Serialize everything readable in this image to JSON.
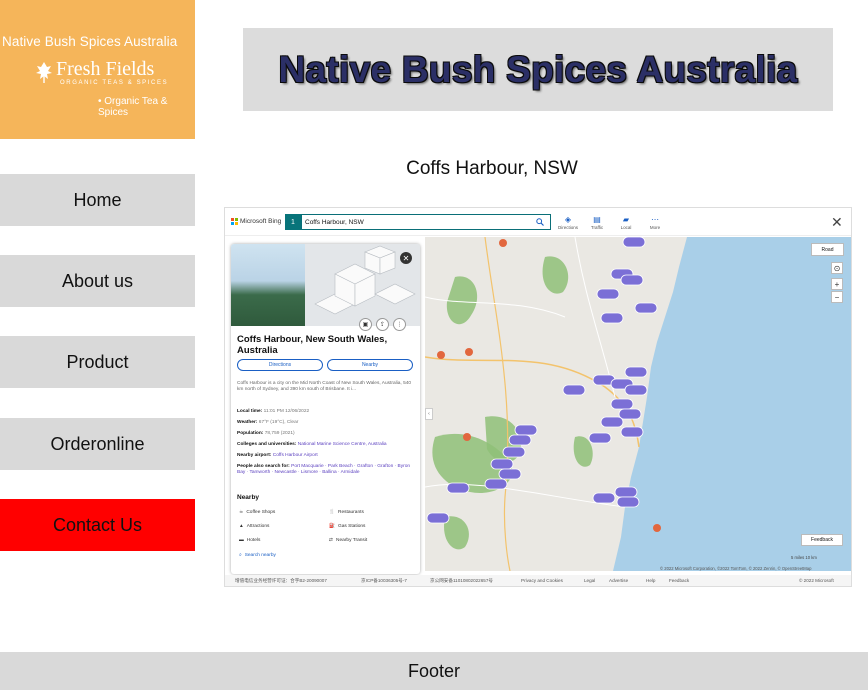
{
  "logo": {
    "line1": "Native Bush Spices Australia",
    "brand": "Fresh Fields",
    "subtitle": "ORGANIC TEAS & SPICES",
    "tagline": "• Organic Tea & Spices"
  },
  "nav": {
    "home": "Home",
    "about": "About us",
    "product": "Product",
    "order": "Orderonline",
    "contact": "Contact Us"
  },
  "banner": {
    "title": "Native Bush Spices Australia"
  },
  "location": {
    "title": "Coffs Harbour, NSW"
  },
  "map": {
    "brand": "Microsoft Bing",
    "result_number": "1",
    "search_value": "Coffs Harbour, NSW",
    "tools": [
      {
        "glyph": "◈",
        "label": "Directions"
      },
      {
        "glyph": "▤",
        "label": "Traffic"
      },
      {
        "glyph": "▰",
        "label": "Local"
      },
      {
        "glyph": "⋯",
        "label": "More"
      }
    ],
    "close": "✕",
    "road_label": "Road",
    "feedback_label": "Feedback",
    "copyright": "© 2022 Microsoft Corporation, ©2022 TomTom, © 2022 Zenrin, © OpenStreetMap",
    "scale_label": "5 miles          10 km",
    "panel": {
      "title": "Coffs Harbour, New South Wales, Australia",
      "directions_label": "Directions",
      "nearby_label": "Nearby",
      "description": "Coffs Harbour is a city on the Mid North Coast of New South Wales, Australia, 540 km north of Sydney, and 390 km south of Brisbane. It i...",
      "local_time_label": "Local time:",
      "local_time_value": "11:01 PM 12/06/2022",
      "weather_label": "Weather:",
      "weather_value": "67°F (19°C), Clear",
      "population_label": "Population:",
      "population_value": "78,759 (2021)",
      "colleges_label": "Colleges and universities:",
      "colleges_value": "National Marine Science Centre, Australia",
      "airport_label": "Nearby airport:",
      "airport_value": "Coffs Harbour Airport",
      "people_label": "People also search for:",
      "people_value": "Port Macquarie · Park Beach · Grafton · Grafton · Byron Bay · Tamworth · Newcastle · Lismore · Ballina · Armidale",
      "nearby_heading": "Nearby",
      "nearby": [
        {
          "icon": "☕",
          "label": "Coffee Shops"
        },
        {
          "icon": "🍴",
          "label": "Restaurants"
        },
        {
          "icon": "▲",
          "label": "Attractions"
        },
        {
          "icon": "⛽",
          "label": "Gas Stations"
        },
        {
          "icon": "▬",
          "label": "Hotels"
        },
        {
          "icon": "⇄",
          "label": "Nearby Transit"
        }
      ],
      "search_nearby": "Search nearby"
    },
    "bottom_links": [
      "增值电信业务经营许可证：合字B2-20090007",
      "京ICP备10036305号-7",
      "京公网安备11010802022657号",
      "Privacy and Cookies",
      "Legal",
      "Advertise",
      "Help",
      "Feedback",
      "© 2022 Microsoft"
    ]
  },
  "footer": {
    "text": "Footer"
  },
  "colors": {
    "logo_bg": "#f5b55a",
    "nav_bg": "#d9d9d9",
    "contact_bg": "#ff0000",
    "banner_bg": "#dcdcdc",
    "title_fill": "#2b2f66",
    "map_sea": "#a9cfe8",
    "map_land": "#eae8e3",
    "map_park": "#8fbf78",
    "pin": "#7b6fd6"
  }
}
